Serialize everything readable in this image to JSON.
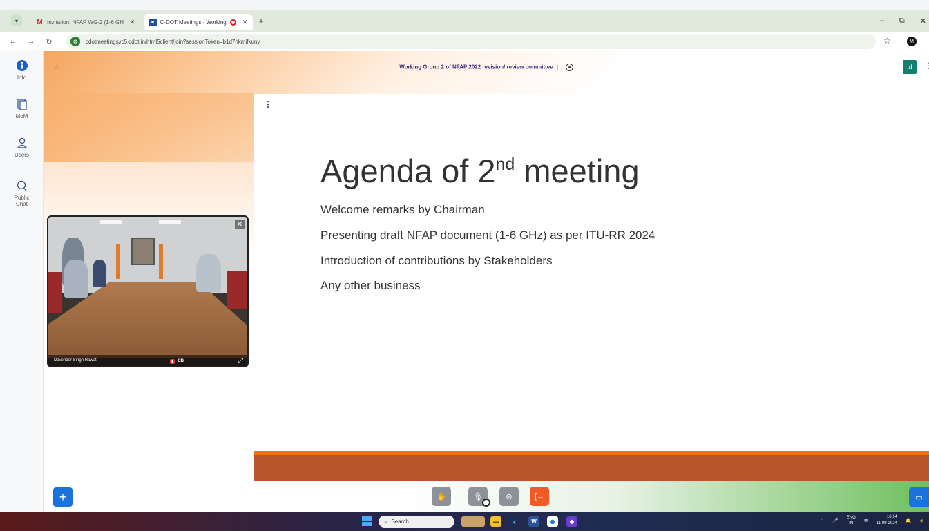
{
  "browser": {
    "tabs": [
      {
        "label": "Invitation: NFAP WG-2 (1-6 GH",
        "active": false
      },
      {
        "label": "C-DOT Meetings - Working",
        "active": true
      }
    ],
    "url": "cdotmeetingsvc5.cdot.in/html5client/join?sessionToken=b1d7nkmifkuny",
    "profile_initial": "M"
  },
  "sidebar": {
    "items": [
      {
        "label": "Info",
        "icon": "info-icon"
      },
      {
        "label": "MoM",
        "icon": "document-icon"
      },
      {
        "label": "Users",
        "icon": "user-icon"
      },
      {
        "label": "Public Chat",
        "icon": "chat-icon"
      }
    ]
  },
  "meeting": {
    "title": "Working Group 2 of NFAP 2022 revision/ review committee"
  },
  "slide": {
    "title_pre": "Agenda of 2",
    "title_sup": "nd",
    "title_post": " meeting",
    "bullets": [
      "Welcome remarks by Chairman",
      "Presenting draft NFAP document (1-6 GHz) as per ITU-RR 2024",
      "Introduction of contributions by Stakeholders",
      "Any other business"
    ]
  },
  "video": {
    "participant": "Davender Singh Rawat -",
    "badge": "CB"
  },
  "taskbar": {
    "search_placeholder": "Search",
    "lang": "ENG",
    "lang_region": "IN",
    "time": "16:14",
    "date": "11-09-2024"
  },
  "colors": {
    "accent_blue": "#1a73d9",
    "slide_band": "#b7562b",
    "leave_button": "#f15a24",
    "stats_button": "#13806b"
  }
}
